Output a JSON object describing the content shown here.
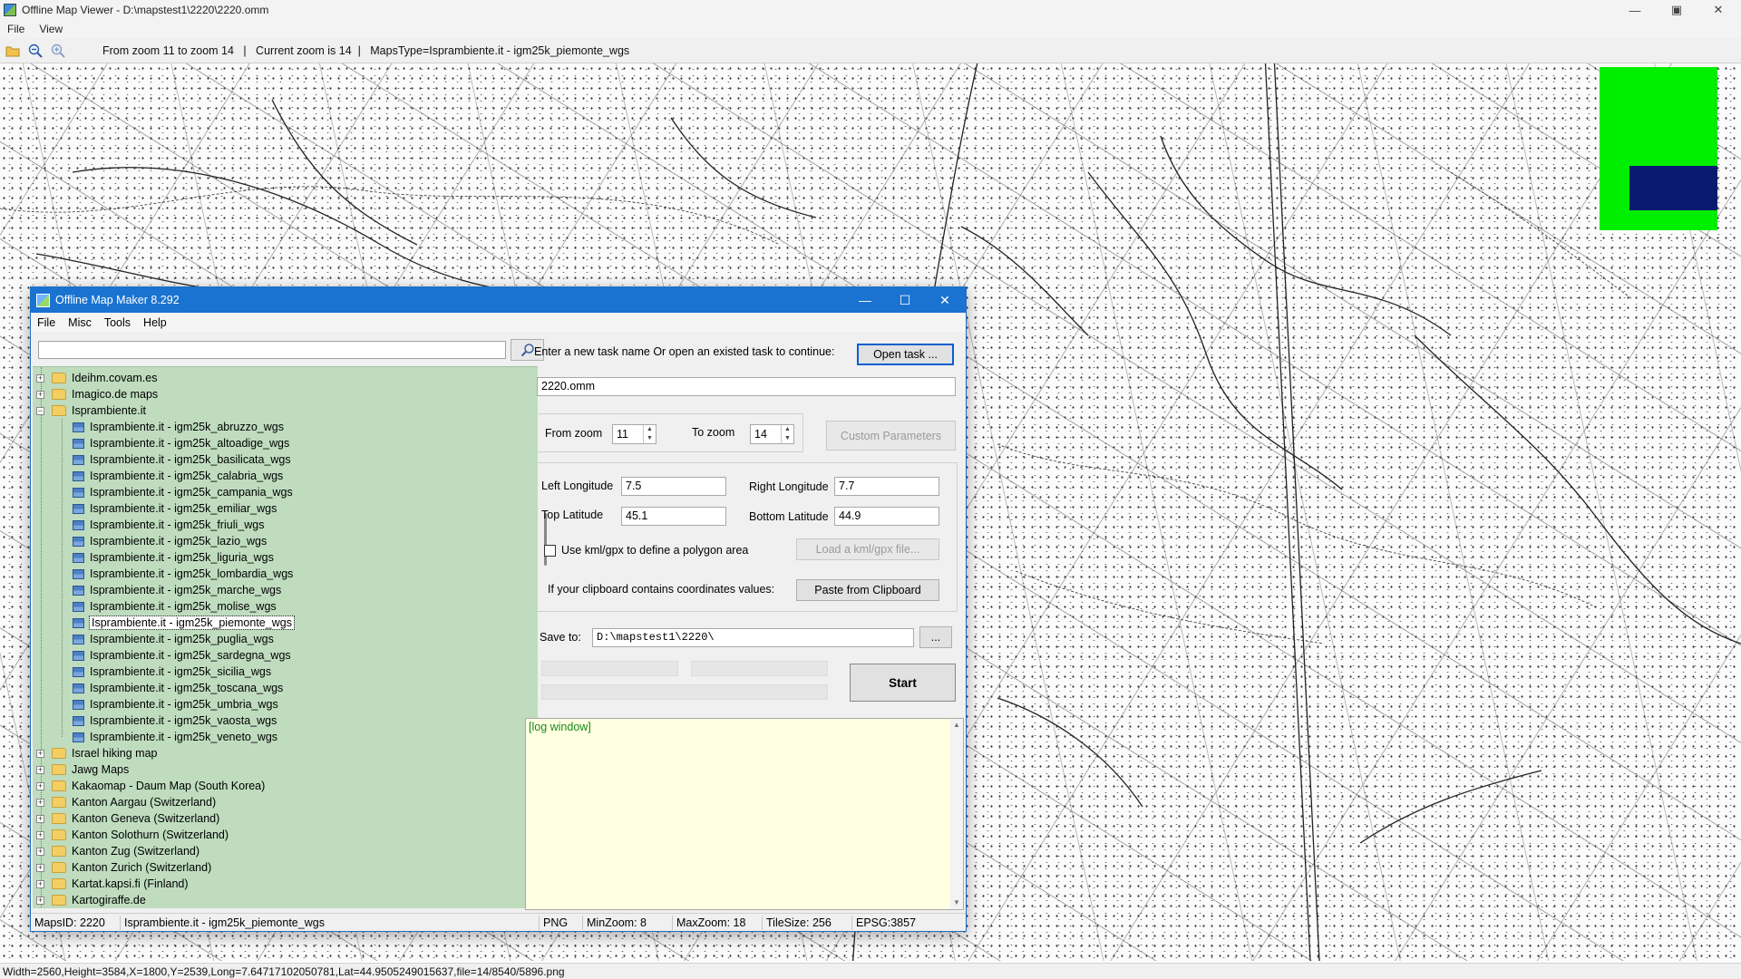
{
  "viewer": {
    "title": "Offline Map Viewer - D:\\mapstest1\\2220\\2220.omm",
    "menu": [
      "File",
      "View"
    ],
    "toolbar_text": "From zoom 11 to zoom 14   |   Current zoom is 14  |   MapsType=Isprambiente.it - igm25k_piemonte_wgs",
    "toolbar_icons": [
      "open-folder-icon",
      "zoom-out-icon",
      "zoom-in-icon"
    ],
    "statusbar": "Width=2560,Height=3584,X=1800,Y=2539,Long=7.64717102050781,Lat=44.9505249015637,file=14/8540/5896.png",
    "overview_colors": {
      "area": "#00ee00",
      "view": "#0a1a6e"
    }
  },
  "omm": {
    "title": "Offline Map Maker 8.292",
    "menu": [
      "File",
      "Misc",
      "Tools",
      "Help"
    ],
    "search": {
      "value": "",
      "placeholder": ""
    },
    "tree": [
      {
        "label": "Ideihm.covam.es",
        "type": "folder",
        "expanded": false
      },
      {
        "label": "Imagico.de maps",
        "type": "folder",
        "expanded": false
      },
      {
        "label": "Isprambiente.it",
        "type": "folder",
        "expanded": true
      },
      {
        "label": "Isprambiente.it - igm25k_abruzzo_wgs",
        "type": "map"
      },
      {
        "label": "Isprambiente.it - igm25k_altoadige_wgs",
        "type": "map"
      },
      {
        "label": "Isprambiente.it - igm25k_basilicata_wgs",
        "type": "map"
      },
      {
        "label": "Isprambiente.it - igm25k_calabria_wgs",
        "type": "map"
      },
      {
        "label": "Isprambiente.it - igm25k_campania_wgs",
        "type": "map"
      },
      {
        "label": "Isprambiente.it - igm25k_emiliar_wgs",
        "type": "map"
      },
      {
        "label": "Isprambiente.it - igm25k_friuli_wgs",
        "type": "map"
      },
      {
        "label": "Isprambiente.it - igm25k_lazio_wgs",
        "type": "map"
      },
      {
        "label": "Isprambiente.it - igm25k_liguria_wgs",
        "type": "map"
      },
      {
        "label": "Isprambiente.it - igm25k_lombardia_wgs",
        "type": "map"
      },
      {
        "label": "Isprambiente.it - igm25k_marche_wgs",
        "type": "map"
      },
      {
        "label": "Isprambiente.it - igm25k_molise_wgs",
        "type": "map"
      },
      {
        "label": "Isprambiente.it - igm25k_piemonte_wgs",
        "type": "map",
        "selected": true
      },
      {
        "label": "Isprambiente.it - igm25k_puglia_wgs",
        "type": "map"
      },
      {
        "label": "Isprambiente.it - igm25k_sardegna_wgs",
        "type": "map"
      },
      {
        "label": "Isprambiente.it - igm25k_sicilia_wgs",
        "type": "map"
      },
      {
        "label": "Isprambiente.it - igm25k_toscana_wgs",
        "type": "map"
      },
      {
        "label": "Isprambiente.it - igm25k_umbria_wgs",
        "type": "map"
      },
      {
        "label": "Isprambiente.it - igm25k_vaosta_wgs",
        "type": "map"
      },
      {
        "label": "Isprambiente.it - igm25k_veneto_wgs",
        "type": "map"
      },
      {
        "label": "Israel hiking map",
        "type": "folder",
        "expanded": false
      },
      {
        "label": "Jawg Maps",
        "type": "folder",
        "expanded": false
      },
      {
        "label": "Kakaomap - Daum Map (South Korea)",
        "type": "folder",
        "expanded": false
      },
      {
        "label": "Kanton Aargau (Switzerland)",
        "type": "folder",
        "expanded": false
      },
      {
        "label": "Kanton Geneva (Switzerland)",
        "type": "folder",
        "expanded": false
      },
      {
        "label": "Kanton Solothurn (Switzerland)",
        "type": "folder",
        "expanded": false
      },
      {
        "label": "Kanton Zug (Switzerland)",
        "type": "folder",
        "expanded": false
      },
      {
        "label": "Kanton Zurich (Switzerland)",
        "type": "folder",
        "expanded": false
      },
      {
        "label": "Kartat.kapsi.fi (Finland)",
        "type": "folder",
        "expanded": false
      },
      {
        "label": "Kartogiraffe.de",
        "type": "folder",
        "expanded": false
      }
    ],
    "task": {
      "prompt": "Enter a new task name Or open an existed task to continue:",
      "open_button": "Open task ...",
      "name": "2220.omm"
    },
    "zoom": {
      "from_label": "From zoom",
      "from_value": "11",
      "to_label": "To zoom",
      "to_value": "14",
      "custom_button": "Custom Parameters"
    },
    "coords": {
      "left_lon_label": "Left Longitude",
      "left_lon": "7.5",
      "right_lon_label": "Right Longitude",
      "right_lon": "7.7",
      "top_lat_label": "Top Latitude",
      "top_lat": "45.1",
      "bottom_lat_label": "Bottom Latitude",
      "bottom_lat": "44.9",
      "kml_checkbox_label": "Use kml/gpx to define a polygon area",
      "kml_checked": false,
      "load_kml_button": "Load a kml/gpx file...",
      "clipboard_label": "If your clipboard contains coordinates values:",
      "paste_button": "Paste from Clipboard"
    },
    "save": {
      "label": "Save to:",
      "path": "D:\\mapstest1\\2220\\",
      "browse_button": "...",
      "start_button": "Start"
    },
    "log": {
      "text": "[log window]"
    },
    "status": {
      "maps_id": "MapsID: 2220",
      "map_name": "Isprambiente.it - igm25k_piemonte_wgs",
      "format": "PNG",
      "min_zoom": "MinZoom: 8",
      "max_zoom": "MaxZoom: 18",
      "tile_size": "TileSize: 256",
      "epsg": "EPSG:3857"
    }
  }
}
